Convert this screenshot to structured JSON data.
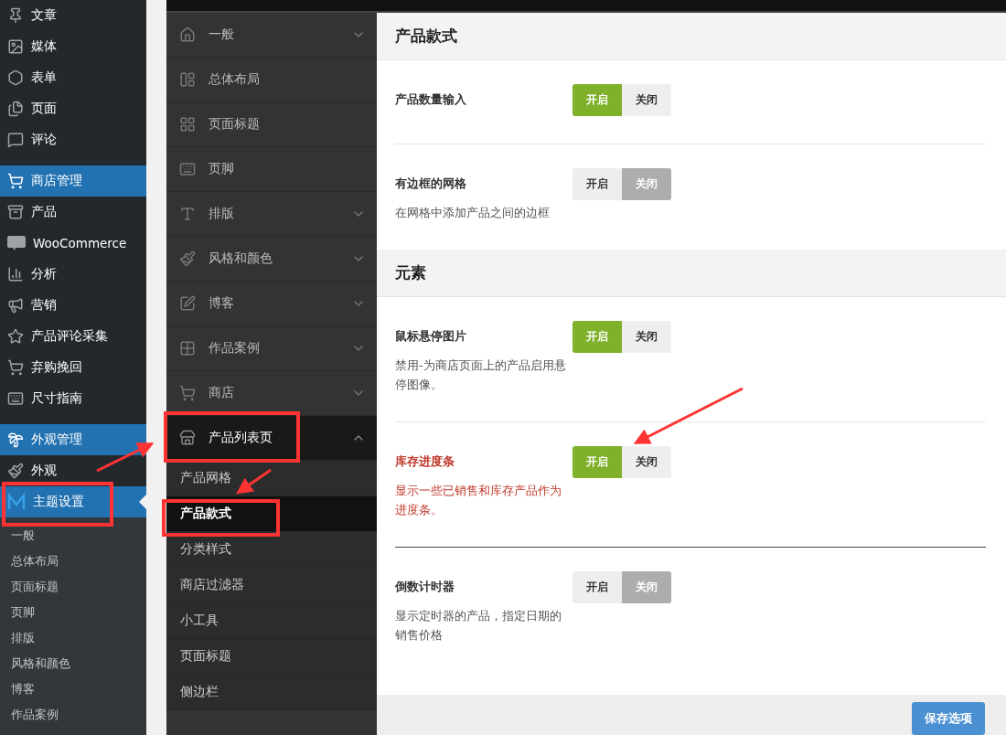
{
  "admin_menu": {
    "items": [
      {
        "label": "文章",
        "selected": false
      },
      {
        "label": "媒体",
        "selected": false
      },
      {
        "label": "表单",
        "selected": false
      },
      {
        "label": "页面",
        "selected": false
      },
      {
        "label": "评论",
        "selected": false
      },
      {
        "label": "商店管理",
        "selected": true
      },
      {
        "label": "产品",
        "selected": false
      },
      {
        "label": "WooCommerce",
        "selected": false
      },
      {
        "label": "分析",
        "selected": false
      },
      {
        "label": "营销",
        "selected": false
      },
      {
        "label": "产品评论采集",
        "selected": false
      },
      {
        "label": "弃购挽回",
        "selected": false
      },
      {
        "label": "尺寸指南",
        "selected": false
      },
      {
        "label": "外观管理",
        "selected": true
      },
      {
        "label": "外观",
        "selected": false
      },
      {
        "label": "主题设置",
        "selected": true
      }
    ],
    "submenu": [
      "一般",
      "总体布局",
      "页面标题",
      "页脚",
      "排版",
      "风格和颜色",
      "博客",
      "作品案例"
    ]
  },
  "options_menu": {
    "items": [
      {
        "label": "一般",
        "expanded": false,
        "has_children": true
      },
      {
        "label": "总体布局",
        "expanded": false,
        "has_children": false
      },
      {
        "label": "页面标题",
        "expanded": false,
        "has_children": false
      },
      {
        "label": "页脚",
        "expanded": false,
        "has_children": false
      },
      {
        "label": "排版",
        "expanded": false,
        "has_children": true
      },
      {
        "label": "风格和颜色",
        "expanded": false,
        "has_children": true
      },
      {
        "label": "博客",
        "expanded": false,
        "has_children": true
      },
      {
        "label": "作品案例",
        "expanded": false,
        "has_children": true
      },
      {
        "label": "商店",
        "expanded": false,
        "has_children": true
      },
      {
        "label": "产品列表页",
        "expanded": true,
        "has_children": true,
        "children": [
          {
            "label": "产品网格",
            "selected": false
          },
          {
            "label": "产品款式",
            "selected": true
          },
          {
            "label": "分类样式",
            "selected": false
          },
          {
            "label": "商店过滤器",
            "selected": false
          },
          {
            "label": "小工具",
            "selected": false
          },
          {
            "label": "页面标题",
            "selected": false
          },
          {
            "label": "侧边栏",
            "selected": false
          }
        ]
      }
    ]
  },
  "sections": [
    {
      "title": "产品款式",
      "options": [
        {
          "label": "产品数量输入",
          "on": true,
          "emphasized": false,
          "on_label": "开启",
          "off_label": "关闭"
        },
        {
          "label": "有边框的网格",
          "description": "在网格中添加产品之间的边框",
          "on": false,
          "emphasized": false,
          "on_label": "开启",
          "off_label": "关闭"
        }
      ]
    },
    {
      "title": "元素",
      "options": [
        {
          "label": "鼠标悬停图片",
          "description": "禁用-为商店页面上的产品启用悬停图像。",
          "on": true,
          "emphasized": false,
          "on_label": "开启",
          "off_label": "关闭"
        },
        {
          "label": "库存进度条",
          "description": "显示一些已销售和库存产品作为进度条。",
          "on": true,
          "emphasized": true,
          "on_label": "开启",
          "off_label": "关闭"
        },
        {
          "label": "倒数计时器",
          "description": "显示定时器的产品，指定日期的销售价格",
          "on": false,
          "emphasized": false,
          "on_label": "开启",
          "off_label": "关闭"
        }
      ]
    }
  ],
  "footer": {
    "save_button": "保存选项"
  }
}
